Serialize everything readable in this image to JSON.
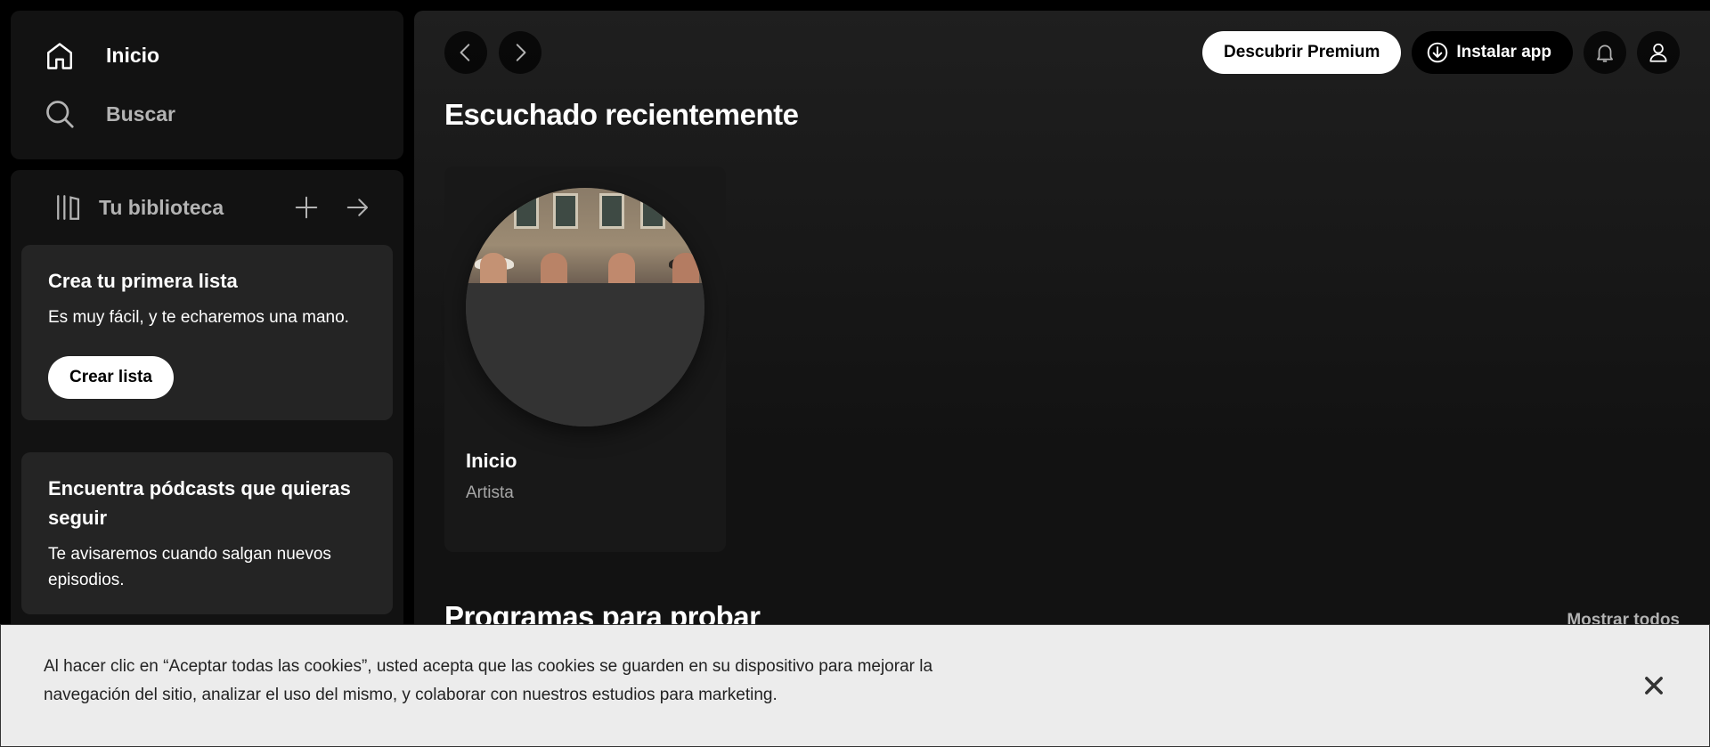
{
  "sidebar": {
    "nav": {
      "home_label": "Inicio",
      "search_label": "Buscar"
    },
    "library": {
      "title": "Tu biblioteca",
      "create_tooltip": "",
      "promos": [
        {
          "title": "Crea tu primera lista",
          "text": "Es muy fácil, y te echaremos una mano.",
          "button": "Crear lista"
        },
        {
          "title": "Encuentra pódcasts que quieras seguir",
          "text": "Te avisaremos cuando salgan nuevos episodios."
        }
      ]
    }
  },
  "topbar": {
    "premium_label": "Descubrir Premium",
    "install_label": "Instalar app"
  },
  "main": {
    "recent_title": "Escuchado recientemente",
    "recent_cards": [
      {
        "title": "Inicio",
        "subtitle": "Artista"
      }
    ],
    "programs_title": "Programas para probar",
    "show_all_label": "Mostrar todos"
  },
  "cookie_banner": {
    "text": "Al hacer clic en “Aceptar todas las cookies”, usted acepta que las cookies se guarden en su dispositivo para mejorar la navegación del sitio, analizar el uso del mismo, y colaborar con nuestros estudios para marketing."
  },
  "colors": {
    "background": "#000000",
    "panel": "#121212",
    "card": "#181818",
    "promo": "#242424",
    "muted_text": "#b3b3b3",
    "cookie_bg": "#ececec"
  },
  "icons": {
    "home": "home-icon",
    "search": "search-icon",
    "library": "library-icon",
    "plus": "plus-icon",
    "arrow_right": "arrow-right-icon",
    "back": "chevron-left-icon",
    "forward": "chevron-right-icon",
    "download": "download-icon",
    "bell": "bell-icon",
    "user": "user-icon",
    "close": "close-icon"
  }
}
